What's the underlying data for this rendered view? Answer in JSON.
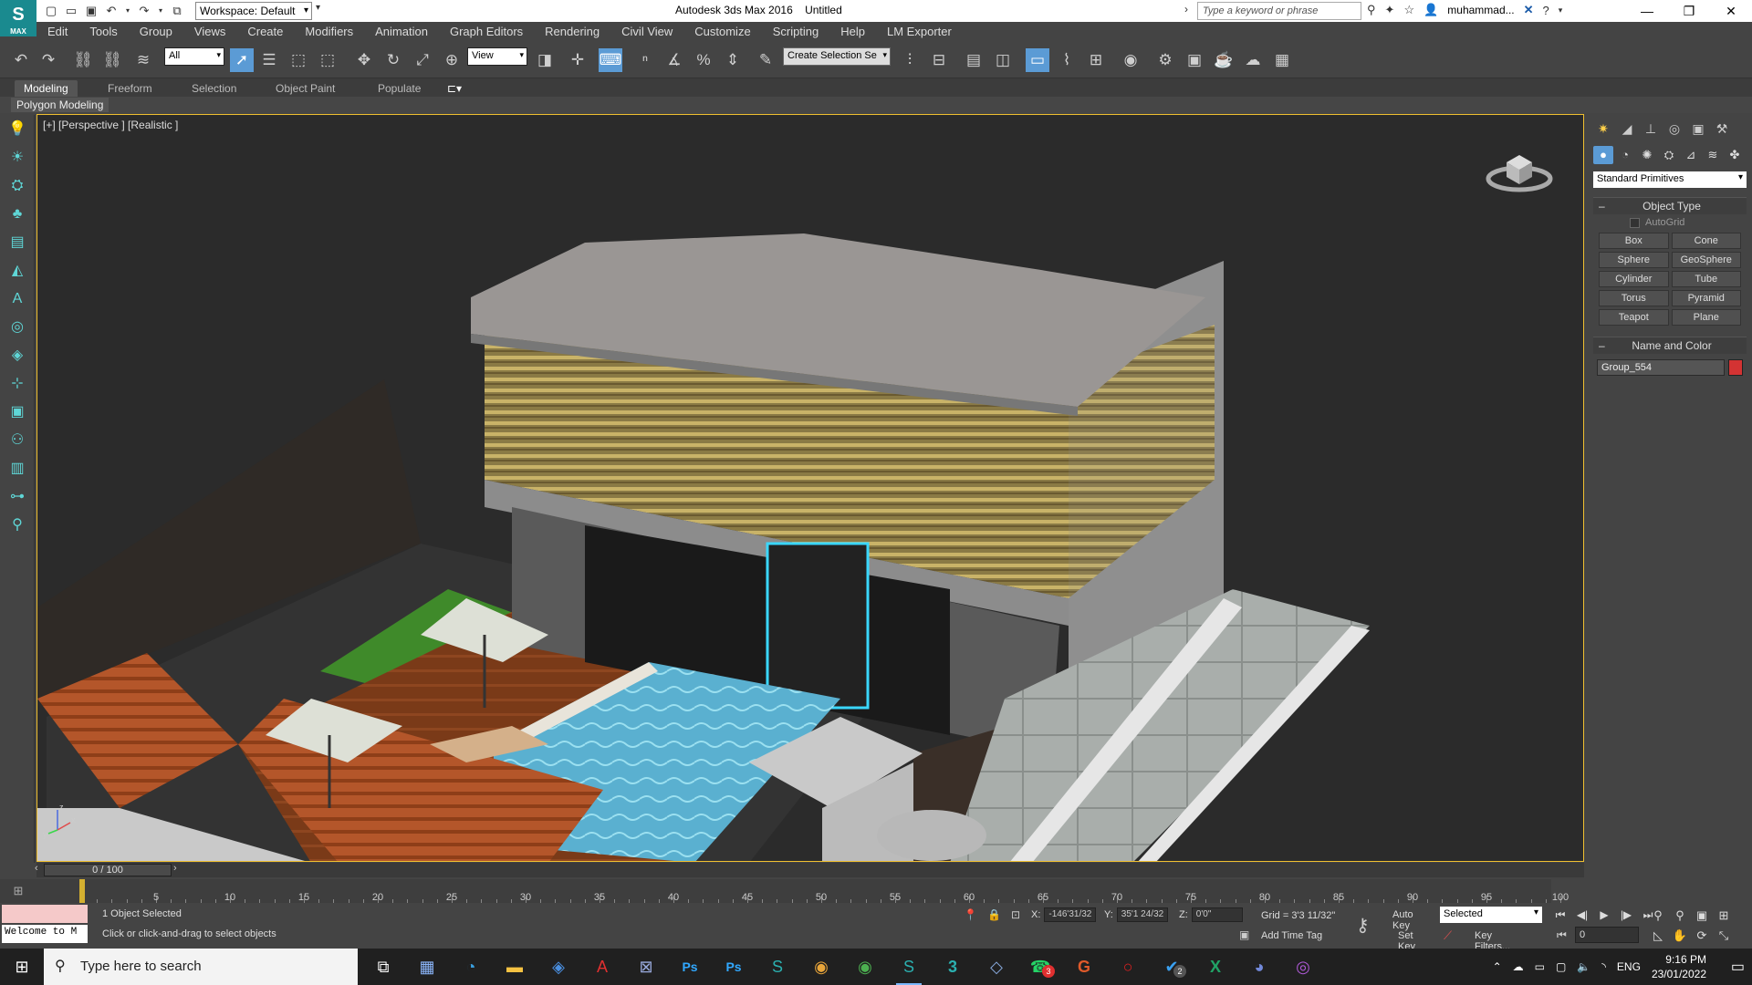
{
  "title": {
    "app_name": "Autodesk 3ds Max 2016",
    "document": "Untitled",
    "workspace": "Workspace: Default",
    "search_placeholder": "Type a keyword or phrase",
    "user": "muhammad...",
    "logo_text": "MAX"
  },
  "menu": [
    "Edit",
    "Tools",
    "Group",
    "Views",
    "Create",
    "Modifiers",
    "Animation",
    "Graph Editors",
    "Rendering",
    "Civil View",
    "Customize",
    "Scripting",
    "Help",
    "LM Exporter"
  ],
  "toolbar": {
    "selection_filter": "All",
    "reference_coord": "View",
    "named_selection": "Create Selection Se"
  },
  "ribbon": {
    "tabs": [
      "Modeling",
      "Freeform",
      "Selection",
      "Object Paint",
      "Populate"
    ],
    "active_tab": "Modeling",
    "sub_label": "Polygon Modeling"
  },
  "viewport": {
    "label": "[+] [Perspective ] [Realistic ]",
    "axis_z": "z",
    "axis_x": "x",
    "axis_y": "y"
  },
  "command_panel": {
    "category": "Standard Primitives",
    "object_type_title": "Object Type",
    "autogrid": "AutoGrid",
    "primitives": [
      "Box",
      "Cone",
      "Sphere",
      "GeoSphere",
      "Cylinder",
      "Tube",
      "Torus",
      "Pyramid",
      "Teapot",
      "Plane"
    ],
    "name_color_title": "Name and Color",
    "object_name": "Group_554",
    "object_color": "#d33333"
  },
  "timeline": {
    "slider": "0 / 100",
    "ticks": [
      "5",
      "10",
      "15",
      "20",
      "25",
      "30",
      "35",
      "40",
      "45",
      "50",
      "55",
      "60",
      "65",
      "70",
      "75",
      "80",
      "85",
      "90",
      "95",
      "100"
    ]
  },
  "status": {
    "welcome": "Welcome to M",
    "selection": "1 Object Selected",
    "prompt": "Click or click-and-drag to select objects",
    "x_label": "X:",
    "x_value": "-146'31/32",
    "y_label": "Y:",
    "y_value": "35'1 24/32",
    "z_label": "Z:",
    "z_value": "0'0\"",
    "grid": "Grid = 3'3 11/32\"",
    "add_time_tag": "Add Time Tag",
    "auto_key": "Auto Key",
    "key_mode": "Selected",
    "set_key": "Set Key",
    "key_filters": "Key Filters...",
    "frame": "0"
  },
  "taskbar": {
    "search": "Type here to search",
    "lang": "ENG",
    "time": "9:16 PM",
    "date": "23/01/2022",
    "whatsapp_badge": "3",
    "vscode_badge": "2"
  }
}
